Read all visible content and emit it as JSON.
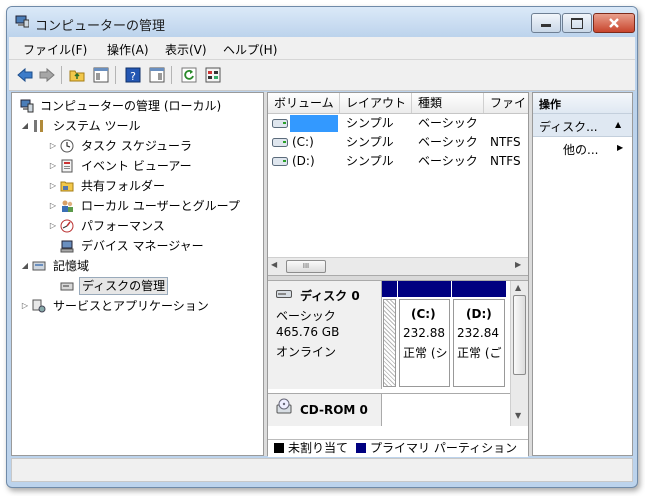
{
  "window": {
    "title": "コンピューターの管理"
  },
  "menu": [
    "ファイル(F)",
    "操作(A)",
    "表示(V)",
    "ヘルプ(H)"
  ],
  "tree": {
    "root": "コンピューターの管理 (ローカル)",
    "system_tools": "システム ツール",
    "task_scheduler": "タスク スケジューラ",
    "event_viewer": "イベント ビューアー",
    "shared_folders": "共有フォルダー",
    "local_users": "ローカル ユーザーとグループ",
    "performance": "パフォーマンス",
    "device_manager": "デバイス マネージャー",
    "storage": "記憶域",
    "disk_management": "ディスクの管理",
    "services_apps": "サービスとアプリケーション"
  },
  "volumes": {
    "columns": [
      "ボリューム",
      "レイアウト",
      "種類",
      "ファイ"
    ],
    "rows": [
      {
        "volume": "",
        "layout": "シンプル",
        "type": "ベーシック",
        "fs": ""
      },
      {
        "volume": "(C:)",
        "layout": "シンプル",
        "type": "ベーシック",
        "fs": "NTFS"
      },
      {
        "volume": "(D:)",
        "layout": "シンプル",
        "type": "ベーシック",
        "fs": "NTFS"
      }
    ],
    "scroll_thumb": "III"
  },
  "disk0": {
    "name": "ディスク 0",
    "type": "ベーシック",
    "size": "465.76 GB",
    "status": "オンライン",
    "partitions": [
      {
        "label": "(C:)",
        "size": "232.88",
        "status": "正常 (シ"
      },
      {
        "label": "(D:)",
        "size": "232.84",
        "status": "正常 (ご"
      }
    ]
  },
  "cdrom": {
    "name": "CD-ROM 0"
  },
  "legend": {
    "unallocated": "未割り当て",
    "primary": "プライマリ パーティション"
  },
  "actions": {
    "header": "操作",
    "section": "ディスク...",
    "more": "他の..."
  },
  "colors": {
    "primary_partition": "#000080",
    "selection": "#3399ff",
    "actions_header": "#dfe8f2"
  }
}
